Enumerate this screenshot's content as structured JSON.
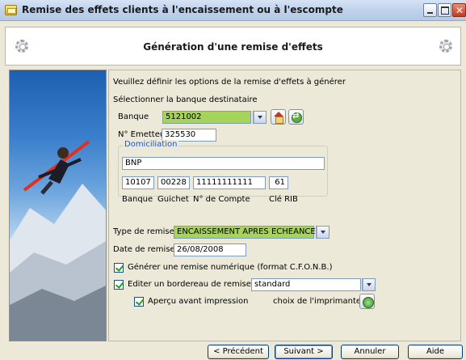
{
  "window": {
    "title": "Remise des effets clients à l'encaissement ou à l'escompte"
  },
  "header": {
    "title": "Génération d'une remise d'effets"
  },
  "form": {
    "intro": "Veuillez définir les options de la remise d'effets à générer",
    "select_bank_label": "Sélectionner la banque destinataire",
    "bank_label": "Banque",
    "bank_value": "5121002",
    "emitter_label": "N° Emetteur",
    "emitter_value": "325530",
    "domiciliation": {
      "title": "Domiciliation",
      "bank_name": "BNP",
      "code_banque": "10107",
      "code_guichet": "00228",
      "numero_compte": "11111111111",
      "cle_rib": "61",
      "col_banque": "Banque",
      "col_guichet": "Guichet",
      "col_compte": "N° de Compte",
      "col_cle": "Clé RIB"
    },
    "type_label": "Type de remise",
    "type_value": "ENCAISSEMENT APRES ECHEANCE",
    "date_label": "Date de remise",
    "date_value": "26/08/2008",
    "numeric_label": "Générer une remise numérique (format C.F.O.N.B.)",
    "numeric_checked": true,
    "bordereau_label": "Editer un bordereau de remise",
    "bordereau_checked": true,
    "bordereau_value": "standard",
    "preview_label": "Aperçu avant impression",
    "preview_checked": true,
    "printer_label": "choix de l'imprimante"
  },
  "buttons": {
    "previous": "< Précédent",
    "next": "Suivant >",
    "cancel": "Annuler",
    "help": "Aide"
  },
  "colors": {
    "highlight_field": "#a6d35a",
    "group_title": "#2457c8"
  },
  "icons": [
    "app-icon",
    "gear-icon",
    "house-icon",
    "swap-icon",
    "printer-icon",
    "chevron-down-icon"
  ]
}
